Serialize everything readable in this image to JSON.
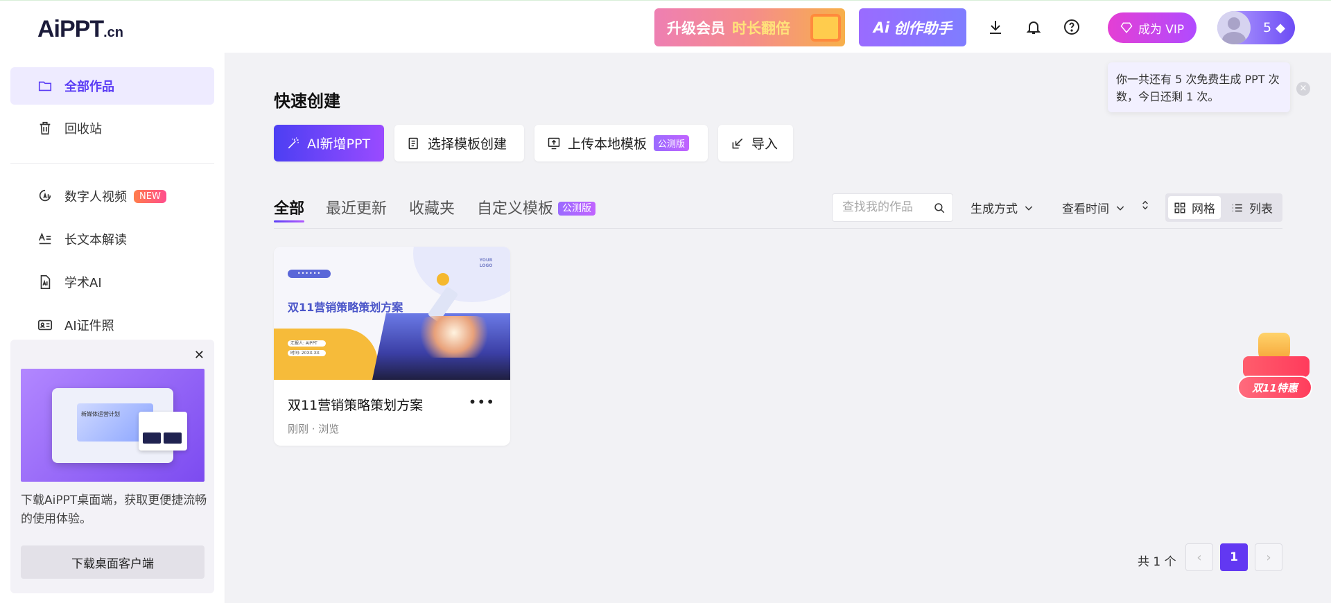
{
  "header": {
    "logo_main": "AiPPT",
    "logo_suffix": ".cn",
    "promo_banner": {
      "part1": "升级会员",
      "part2": "时长翻倍"
    },
    "ai_assistant_label": "创作助手",
    "vip_button": "成为 VIP",
    "user_credits": "5"
  },
  "sidebar": {
    "items": [
      {
        "label": "全部作品",
        "icon": "folder-icon",
        "active": true
      },
      {
        "label": "回收站",
        "icon": "trash-icon",
        "active": false
      },
      {
        "label": "数字人视频",
        "icon": "digital-human-icon",
        "badge": "NEW"
      },
      {
        "label": "长文本解读",
        "icon": "long-text-icon"
      },
      {
        "label": "学术AI",
        "icon": "academic-doc-icon"
      },
      {
        "label": "AI证件照",
        "icon": "id-photo-icon"
      }
    ],
    "download_card": {
      "image_caption": "新媒体运营计划",
      "text": "下载AiPPT桌面端，获取更便捷流畅的使用体验。",
      "button": "下载桌面客户端"
    }
  },
  "main": {
    "quick_create_title": "快速创建",
    "quick_buttons": [
      {
        "label": "AI新增PPT",
        "icon": "magic-wand-icon"
      },
      {
        "label": "选择模板创建",
        "icon": "template-icon"
      },
      {
        "label": "上传本地模板",
        "icon": "upload-icon",
        "badge": "公测版"
      },
      {
        "label": "导入",
        "icon": "import-icon"
      }
    ],
    "tabs": [
      {
        "label": "全部",
        "active": true
      },
      {
        "label": "最近更新"
      },
      {
        "label": "收藏夹"
      },
      {
        "label": "自定义模板",
        "badge": "公测版"
      }
    ],
    "search": {
      "placeholder": "查找我的作品",
      "value": ""
    },
    "filters": {
      "generate_method": "生成方式",
      "view_time": "查看时间"
    },
    "view_toggle": {
      "grid": "网格",
      "list": "列表",
      "selected": "grid"
    },
    "cards": [
      {
        "title": "双11营销策略策划方案",
        "meta": "刚刚 · 浏览",
        "thumb": {
          "title": "双11营销策略策划方案",
          "logo": "YOUR LOGO",
          "tag1": "汇报人: AIPPT",
          "tag2": "时间: 20XX.XX"
        }
      }
    ],
    "pagination": {
      "total_text": "共 1 个",
      "current_page": "1",
      "prev": "‹",
      "next": "›"
    }
  },
  "toast": {
    "text": "你一共还有 5 次免费生成 PPT 次数，今日还剩 1 次。",
    "close": "×"
  },
  "floating_promo": {
    "label": "双11特惠"
  },
  "colors": {
    "accent": "#6238f2",
    "vip_gradient_start": "#e43fd4",
    "vip_gradient_end": "#b04bff",
    "new_badge": "#ff5d6c"
  }
}
